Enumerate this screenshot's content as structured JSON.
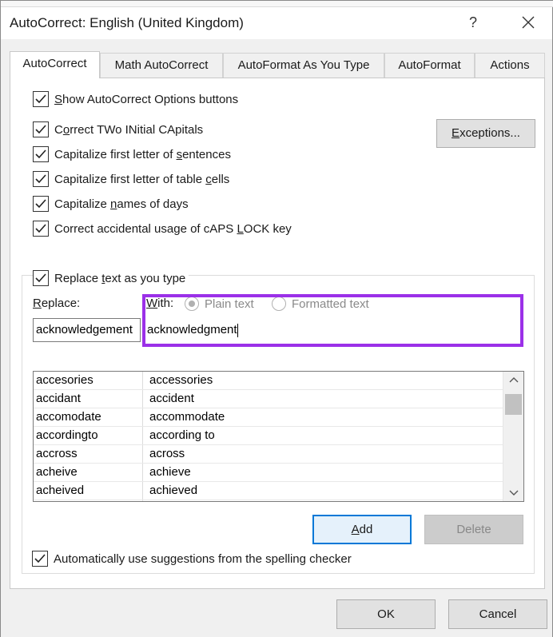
{
  "window": {
    "title": "AutoCorrect: English (United Kingdom)",
    "help_glyph": "?",
    "accent_highlight": "#9b30e8"
  },
  "tabs": [
    {
      "label": "AutoCorrect"
    },
    {
      "label": "Math AutoCorrect"
    },
    {
      "label": "AutoFormat As You Type"
    },
    {
      "label": "AutoFormat"
    },
    {
      "label": "Actions"
    }
  ],
  "options": {
    "show_buttons": {
      "pre": "",
      "ul": "S",
      "post": "how AutoCorrect Options buttons",
      "checked": true
    },
    "two_initial": {
      "pre": "C",
      "ul": "o",
      "post": "rrect TWo INitial CApitals",
      "checked": true
    },
    "first_sentence": {
      "pre": "Capitalize first letter of ",
      "ul": "s",
      "post": "entences",
      "checked": true
    },
    "first_cell": {
      "pre": "Capitalize first letter of table ",
      "ul": "c",
      "post": "ells",
      "checked": true
    },
    "days": {
      "pre": "Capitalize ",
      "ul": "n",
      "post": "ames of days",
      "checked": true
    },
    "caps_lock": {
      "pre": "Correct accidental usage of cAPS ",
      "ul": "L",
      "post": "OCK key",
      "checked": true
    }
  },
  "exceptions_button": {
    "pre": "",
    "ul": "E",
    "post": "xceptions..."
  },
  "replace_section": {
    "replace_as_type": {
      "pre": "Replace ",
      "ul": "t",
      "post": "ext as you type",
      "checked": true
    },
    "replace_label": {
      "pre": "",
      "ul": "R",
      "post": "eplace:"
    },
    "with_label": {
      "pre": "",
      "ul": "W",
      "post": "ith:"
    },
    "plain_text": "Plain text",
    "formatted_text": "Formatted text",
    "replace_value": "acknowledgement",
    "with_value": "acknowledgment"
  },
  "entries": [
    {
      "replace": "accesories",
      "with": "accessories"
    },
    {
      "replace": "accidant",
      "with": "accident"
    },
    {
      "replace": "accomodate",
      "with": "accommodate"
    },
    {
      "replace": "accordingto",
      "with": "according to"
    },
    {
      "replace": "accross",
      "with": "across"
    },
    {
      "replace": "acheive",
      "with": "achieve"
    },
    {
      "replace": "acheived",
      "with": "achieved"
    }
  ],
  "add_button": {
    "pre": "",
    "ul": "A",
    "post": "dd"
  },
  "delete_button": "Delete",
  "spelling_option": {
    "label": "Automatically use suggestions from the spelling checker",
    "checked": true
  },
  "ok_button": "OK",
  "cancel_button": "Cancel"
}
